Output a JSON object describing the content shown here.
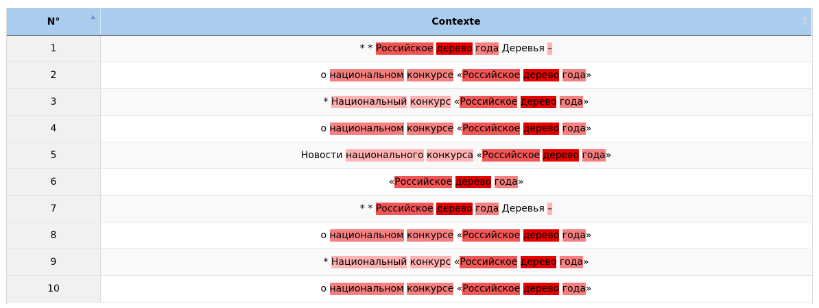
{
  "table": {
    "headers": {
      "num": "N°",
      "context": "Contexte"
    },
    "colors": {
      "h1": "#ffb3b3",
      "h2": "#f58080",
      "h3": "#f25555",
      "h4": "#e60000",
      "header_bg": "#aaccee"
    },
    "rows": [
      {
        "n": "1",
        "tokens": [
          {
            "t": "* * "
          },
          {
            "t": "Российское",
            "h": 3
          },
          {
            "t": " "
          },
          {
            "t": "дерево",
            "h": 4
          },
          {
            "t": " "
          },
          {
            "t": "года",
            "h": 2
          },
          {
            "t": " Деревья "
          },
          {
            "t": "–",
            "h": 1
          }
        ]
      },
      {
        "n": "2",
        "tokens": [
          {
            "t": "о "
          },
          {
            "t": "национальном",
            "h": 2
          },
          {
            "t": " "
          },
          {
            "t": "конкурсе",
            "h": 2
          },
          {
            "t": " «"
          },
          {
            "t": "Российское",
            "h": 3
          },
          {
            "t": " "
          },
          {
            "t": "дерево",
            "h": 4
          },
          {
            "t": " "
          },
          {
            "t": "года",
            "h": 2
          },
          {
            "t": "»"
          }
        ]
      },
      {
        "n": "3",
        "tokens": [
          {
            "t": "* "
          },
          {
            "t": "Национальный",
            "h": 1
          },
          {
            "t": " "
          },
          {
            "t": "конкурс",
            "h": 1
          },
          {
            "t": " «"
          },
          {
            "t": "Российское",
            "h": 3
          },
          {
            "t": " "
          },
          {
            "t": "дерево",
            "h": 4
          },
          {
            "t": " "
          },
          {
            "t": "года",
            "h": 2
          },
          {
            "t": "»"
          }
        ]
      },
      {
        "n": "4",
        "tokens": [
          {
            "t": "о "
          },
          {
            "t": "национальном",
            "h": 2
          },
          {
            "t": " "
          },
          {
            "t": "конкурсе",
            "h": 2
          },
          {
            "t": " «"
          },
          {
            "t": "Российское",
            "h": 3
          },
          {
            "t": " "
          },
          {
            "t": "дерево",
            "h": 4
          },
          {
            "t": " "
          },
          {
            "t": "года",
            "h": 2
          },
          {
            "t": "»"
          }
        ]
      },
      {
        "n": "5",
        "tokens": [
          {
            "t": "Новости "
          },
          {
            "t": "национального",
            "h": 1
          },
          {
            "t": " "
          },
          {
            "t": "конкурса",
            "h": 1
          },
          {
            "t": " «"
          },
          {
            "t": "Российское",
            "h": 3
          },
          {
            "t": " "
          },
          {
            "t": "дерево",
            "h": 4
          },
          {
            "t": " "
          },
          {
            "t": "года",
            "h": 2
          },
          {
            "t": "»"
          }
        ]
      },
      {
        "n": "6",
        "tokens": [
          {
            "t": "«"
          },
          {
            "t": "Российское",
            "h": 3
          },
          {
            "t": " "
          },
          {
            "t": "дерево",
            "h": 4
          },
          {
            "t": " "
          },
          {
            "t": "года",
            "h": 2
          },
          {
            "t": "»"
          }
        ]
      },
      {
        "n": "7",
        "tokens": [
          {
            "t": "* * "
          },
          {
            "t": "Российское",
            "h": 3
          },
          {
            "t": " "
          },
          {
            "t": "дерево",
            "h": 4
          },
          {
            "t": " "
          },
          {
            "t": "года",
            "h": 2
          },
          {
            "t": " Деревья "
          },
          {
            "t": "–",
            "h": 1
          }
        ]
      },
      {
        "n": "8",
        "tokens": [
          {
            "t": "о "
          },
          {
            "t": "национальном",
            "h": 2
          },
          {
            "t": " "
          },
          {
            "t": "конкурсе",
            "h": 2
          },
          {
            "t": " «"
          },
          {
            "t": "Российское",
            "h": 3
          },
          {
            "t": " "
          },
          {
            "t": "дерево",
            "h": 4
          },
          {
            "t": " "
          },
          {
            "t": "года",
            "h": 2
          },
          {
            "t": "»"
          }
        ]
      },
      {
        "n": "9",
        "tokens": [
          {
            "t": "* "
          },
          {
            "t": "Национальный",
            "h": 1
          },
          {
            "t": " "
          },
          {
            "t": "конкурс",
            "h": 1
          },
          {
            "t": " «"
          },
          {
            "t": "Российское",
            "h": 3
          },
          {
            "t": " "
          },
          {
            "t": "дерево",
            "h": 4
          },
          {
            "t": " "
          },
          {
            "t": "года",
            "h": 2
          },
          {
            "t": "»"
          }
        ]
      },
      {
        "n": "10",
        "tokens": [
          {
            "t": "о "
          },
          {
            "t": "национальном",
            "h": 2
          },
          {
            "t": " "
          },
          {
            "t": "конкурсе",
            "h": 2
          },
          {
            "t": " «"
          },
          {
            "t": "Российское",
            "h": 3
          },
          {
            "t": " "
          },
          {
            "t": "дерево",
            "h": 4
          },
          {
            "t": " "
          },
          {
            "t": "года",
            "h": 2
          },
          {
            "t": "»"
          }
        ]
      }
    ]
  }
}
